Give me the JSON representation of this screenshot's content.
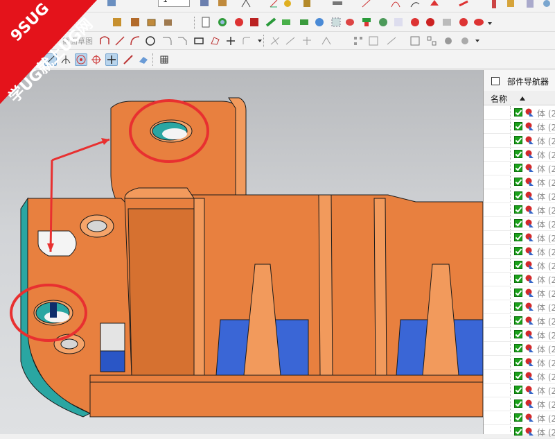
{
  "toolbar": {
    "row1_combo_value": "1",
    "row3_disabled_text": "截面草图",
    "colors": {
      "bar": "#f3f3f3",
      "selected": "#b8d4ec"
    }
  },
  "viewport": {
    "part_color": "#e8803f",
    "edge_color": "#1a1a1a",
    "cavity_color": "#3a66d6",
    "teal_color": "#2aa6a2",
    "annotation_color": "#e83030"
  },
  "watermark": {
    "line1": "9SUG",
    "line2": "学UG就上UG网"
  },
  "navigator": {
    "title": "部件导航器",
    "column_name": "名称",
    "rows": [
      "体 (2",
      "体 (2",
      "体 (2",
      "体 (2",
      "体 (2",
      "体 (2",
      "体 (2",
      "体 (2",
      "体 (2",
      "体 (2",
      "体 (2",
      "体 (2",
      "体 (2",
      "体 (2",
      "体 (2",
      "体 (2",
      "体 (2",
      "体 (2",
      "体 (2",
      "体 (2",
      "体 (2",
      "体 (2",
      "体 (2",
      "体 (2"
    ]
  }
}
